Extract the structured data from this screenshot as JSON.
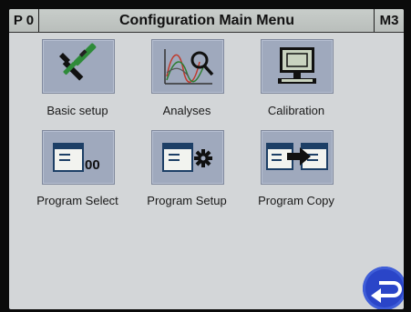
{
  "header": {
    "left_label": "P 0",
    "title": "Configuration Main Menu",
    "right_label": "M3"
  },
  "menu": {
    "items": [
      {
        "label": "Basic setup",
        "icon": "tools-icon"
      },
      {
        "label": "Analyses",
        "icon": "analyses-chart-icon"
      },
      {
        "label": "Calibration",
        "icon": "monitor-icon"
      },
      {
        "label": "Program Select",
        "icon": "window-00-icon",
        "icon_text": "00"
      },
      {
        "label": "Program Setup",
        "icon": "window-gear-icon"
      },
      {
        "label": "Program Copy",
        "icon": "window-copy-icon"
      }
    ]
  },
  "back_button": {
    "icon": "back-arrow-icon"
  },
  "colors": {
    "tile_bg": "#9fa9bd",
    "screen_bg": "#d3d6d8",
    "back_button": "#2a45c8"
  }
}
